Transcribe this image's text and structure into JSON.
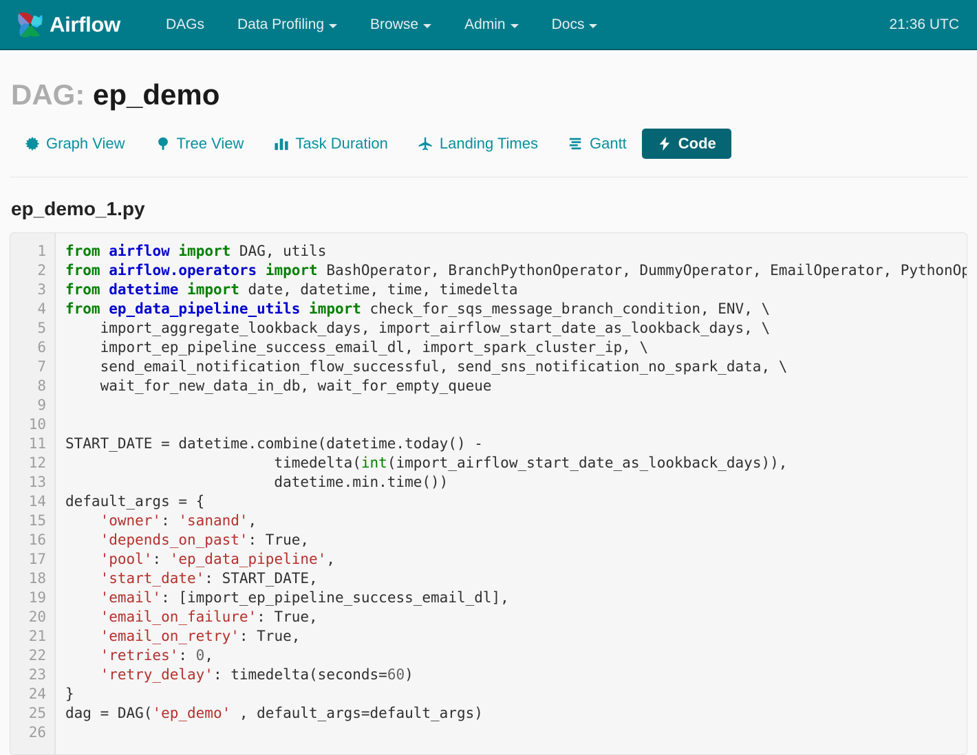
{
  "navbar": {
    "brand": "Airflow",
    "logo_icon": "airflow-pinwheel-logo",
    "items": [
      {
        "label": "DAGs",
        "has_caret": false
      },
      {
        "label": "Data Profiling",
        "has_caret": true
      },
      {
        "label": "Browse",
        "has_caret": true
      },
      {
        "label": "Admin",
        "has_caret": true
      },
      {
        "label": "Docs",
        "has_caret": true
      }
    ],
    "clock": "21:36 UTC",
    "bg_color": "#017b8a"
  },
  "page": {
    "title_prefix": "DAG:",
    "title_name": "ep_demo",
    "file_name": "ep_demo_1.py"
  },
  "tabs": [
    {
      "label": "Graph View",
      "icon": "starburst-icon",
      "active": false
    },
    {
      "label": "Tree View",
      "icon": "tree-icon",
      "active": false
    },
    {
      "label": "Task Duration",
      "icon": "bar-chart-icon",
      "active": false
    },
    {
      "label": "Landing Times",
      "icon": "plane-icon",
      "active": false
    },
    {
      "label": "Gantt",
      "icon": "gantt-icon",
      "active": false
    },
    {
      "label": "Code",
      "icon": "bolt-icon",
      "active": true
    }
  ],
  "code": {
    "accent_color": "#0a8f9e",
    "active_tab_color": "#056573",
    "line_numbers": [
      1,
      2,
      3,
      4,
      5,
      6,
      7,
      8,
      9,
      10,
      11,
      12,
      13,
      14,
      15,
      16,
      17,
      18,
      19,
      20,
      21,
      22,
      23,
      24,
      25,
      26
    ],
    "lines": [
      "from airflow import DAG, utils",
      "from airflow.operators import BashOperator, BranchPythonOperator, DummyOperator, EmailOperator, PythonOperator",
      "from datetime import date, datetime, time, timedelta",
      "from ep_data_pipeline_utils import check_for_sqs_message_branch_condition, ENV, \\",
      "    import_aggregate_lookback_days, import_airflow_start_date_as_lookback_days, \\",
      "    import_ep_pipeline_success_email_dl, import_spark_cluster_ip, \\",
      "    send_email_notification_flow_successful, send_sns_notification_no_spark_data, \\",
      "    wait_for_new_data_in_db, wait_for_empty_queue",
      "",
      "",
      "START_DATE = datetime.combine(datetime.today() -",
      "                        timedelta(int(import_airflow_start_date_as_lookback_days)),",
      "                        datetime.min.time())",
      "default_args = {",
      "    'owner': 'sanand',",
      "    'depends_on_past': True,",
      "    'pool': 'ep_data_pipeline',",
      "    'start_date': START_DATE,",
      "    'email': [import_ep_pipeline_success_email_dl],",
      "    'email_on_failure': True,",
      "    'email_on_retry': True,",
      "    'retries': 0,",
      "    'retry_delay': timedelta(seconds=60)",
      "}",
      "dag = DAG('ep_demo' , default_args=default_args)",
      ""
    ],
    "highlighted_html": [
      "<span class=\"k\">from</span> <span class=\"nn\">airflow</span> <span class=\"k\">import</span> DAG, utils",
      "<span class=\"k\">from</span> <span class=\"nn\">airflow.operators</span> <span class=\"k\">import</span> BashOperator, BranchPythonOperator, DummyOperator, EmailOperator, PythonOperator",
      "<span class=\"k\">from</span> <span class=\"nn\">datetime</span> <span class=\"k\">import</span> date, datetime, time, timedelta",
      "<span class=\"k\">from</span> <span class=\"nn\">ep_data_pipeline_utils</span> <span class=\"k\">import</span> check_for_sqs_message_branch_condition, ENV, \\",
      "    import_aggregate_lookback_days, import_airflow_start_date_as_lookback_days, \\",
      "    import_ep_pipeline_success_email_dl, import_spark_cluster_ip, \\",
      "    send_email_notification_flow_successful, send_sns_notification_no_spark_data, \\",
      "    wait_for_new_data_in_db, wait_for_empty_queue",
      "",
      "",
      "START_DATE = datetime.combine(datetime.today() -",
      "                        timedelta(<span class=\"bi\">int</span>(import_airflow_start_date_as_lookback_days)),",
      "                        datetime.min.time())",
      "default_args = {",
      "    <span class=\"s\">'owner'</span>: <span class=\"s\">'sanand'</span>,",
      "    <span class=\"s\">'depends_on_past'</span>: True,",
      "    <span class=\"s\">'pool'</span>: <span class=\"s\">'ep_data_pipeline'</span>,",
      "    <span class=\"s\">'start_date'</span>: START_DATE,",
      "    <span class=\"s\">'email'</span>: [import_ep_pipeline_success_email_dl],",
      "    <span class=\"s\">'email_on_failure'</span>: True,",
      "    <span class=\"s\">'email_on_retry'</span>: True,",
      "    <span class=\"s\">'retries'</span>: <span class=\"mi\">0</span>,",
      "    <span class=\"s\">'retry_delay'</span>: timedelta(seconds=<span class=\"mi\">60</span>)",
      "}",
      "dag = DAG(<span class=\"s\">'ep_demo'</span> , default_args=default_args)",
      ""
    ]
  }
}
